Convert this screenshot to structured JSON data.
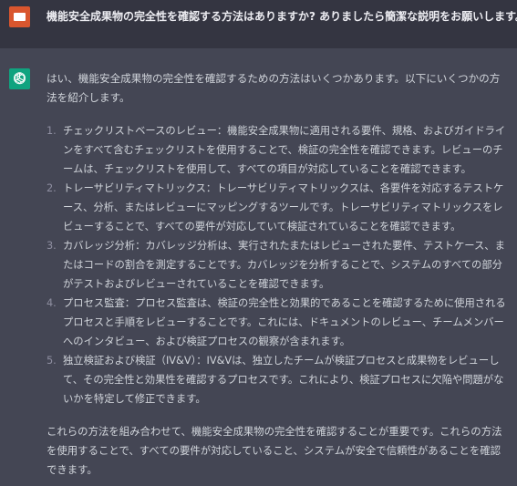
{
  "user_message": {
    "text": "機能安全成果物の完全性を確認する方法はありますか? ありましたら簡潔な説明をお願いします。"
  },
  "assistant_message": {
    "intro": "はい、機能安全成果物の完全性を確認するための方法はいくつかあります。以下にいくつかの方法を紹介します。",
    "items": [
      {
        "num": "1.",
        "text": "チェックリストベースのレビュー：機能安全成果物に適用される要件、規格、およびガイドラインをすべて含むチェックリストを使用することで、検証の完全性を確認できます。レビューのチームは、チェックリストを使用して、すべての項目が対応していることを確認できます。"
      },
      {
        "num": "2.",
        "text": "トレーサビリティマトリックス：トレーサビリティマトリックスは、各要件を対応するテストケース、分析、またはレビューにマッピングするツールです。トレーサビリティマトリックスをレビューすることで、すべての要件が対応していて検証されていることを確認できます。"
      },
      {
        "num": "3.",
        "text": "カバレッジ分析：カバレッジ分析は、実行されたまたはレビューされた要件、テストケース、またはコードの割合を測定することです。カバレッジを分析することで、システムのすべての部分がテストおよびレビューされていることを確認できます。"
      },
      {
        "num": "4.",
        "text": "プロセス監査：プロセス監査は、検証の完全性と効果的であることを確認するために使用されるプロセスと手順をレビューすることです。これには、ドキュメントのレビュー、チームメンバーへのインタビュー、および検証プロセスの観察が含まれます。"
      },
      {
        "num": "5.",
        "text": "独立検証および検証（IV&V）：IV&Vは、独立したチームが検証プロセスと成果物をレビューして、その完全性と効果性を確認するプロセスです。これにより、検証プロセスに欠陥や問題がないかを特定して修正できます。"
      }
    ],
    "outro": "これらの方法を組み合わせて、機能安全成果物の完全性を確認することが重要です。これらの方法を使用することで、すべての要件が対応していること、システムが安全で信頼性があることを確認できます。"
  },
  "colors": {
    "user_bg": "#343541",
    "assistant_bg": "#444654",
    "user_avatar": "#d9562e",
    "assistant_avatar": "#10a37f"
  },
  "icons": {
    "user_avatar": "user-avatar-icon",
    "assistant_avatar": "openai-logo-icon"
  }
}
